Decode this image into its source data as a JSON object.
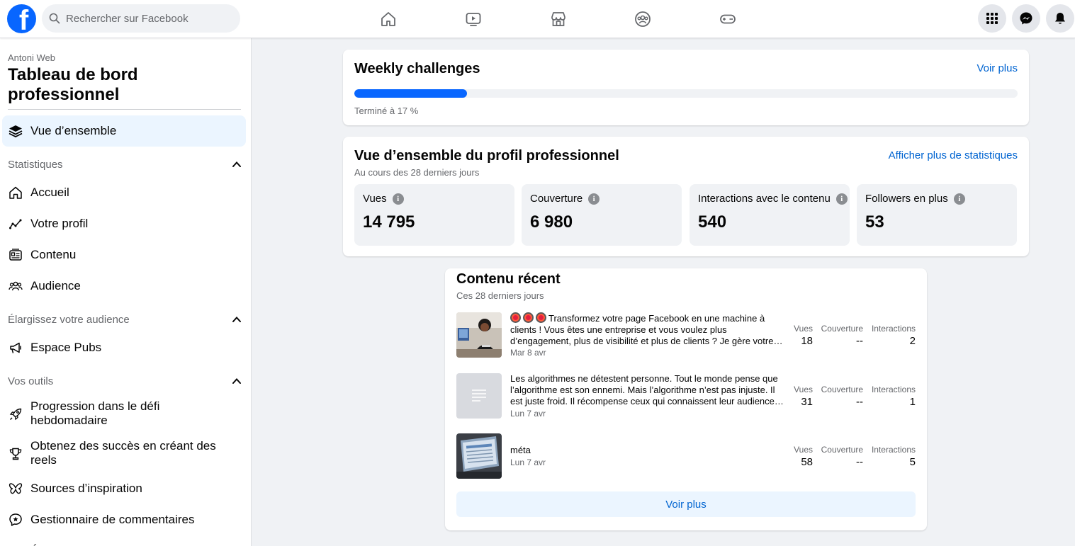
{
  "header": {
    "search_placeholder": "Rechercher sur Facebook",
    "logo_letter": "f",
    "nav_icons": [
      "home-icon",
      "video-icon",
      "marketplace-icon",
      "groups-icon",
      "gaming-icon"
    ],
    "right_icons": [
      "menu-grid-icon",
      "messenger-icon",
      "notifications-icon"
    ]
  },
  "sidebar": {
    "owner": "Antoni Web",
    "title": "Tableau de bord professionnel",
    "overview_label": "Vue d’ensemble",
    "sections": {
      "stats": "Statistiques",
      "expand": "Élargissez votre audience",
      "tools": "Vos outils"
    },
    "items": {
      "accueil": "Accueil",
      "profil": "Votre profil",
      "contenu": "Contenu",
      "audience": "Audience",
      "pubs": "Espace Pubs",
      "progression": "Progression dans le défi hebdomadaire",
      "succes": "Obtenez des succès en créant des reels",
      "inspiration": "Sources d’inspiration",
      "commentaires": "Gestionnaire de commentaires",
      "partial": "É"
    }
  },
  "weekly": {
    "title": "Weekly challenges",
    "link": "Voir plus",
    "progress_pct": 17,
    "status": "Terminé à 17 %"
  },
  "overview": {
    "title": "Vue d’ensemble du profil professionnel",
    "subtitle": "Au cours des 28 derniers jours",
    "link": "Afficher plus de statistiques",
    "stats": [
      {
        "label": "Vues",
        "value": "14 795"
      },
      {
        "label": "Couverture",
        "value": "6 980"
      },
      {
        "label": "Interactions avec le contenu",
        "value": "540"
      },
      {
        "label": "Followers en plus",
        "value": "53"
      }
    ]
  },
  "recent": {
    "title": "Contenu récent",
    "subtitle": "Ces 28 derniers jours",
    "metric_labels": {
      "views": "Vues",
      "reach": "Couverture",
      "interactions": "Interactions"
    },
    "posts": [
      {
        "text": "Transformez votre page Facebook en une machine à clients ! Vous êtes une entreprise et vous voulez plus d’engagement, plus de visibilité et plus de clients ? Je gère votre…",
        "date": "Mar 8 avr",
        "views": "18",
        "reach": "--",
        "interactions": "2"
      },
      {
        "text": "Les algorithmes ne détestent personne. Tout le monde pense que l’algorithme est son ennemi. Mais l’algorithme n’est pas injuste. Il est juste froid. Il récompense ceux qui connaissent leur audience…",
        "date": "Lun 7 avr",
        "views": "31",
        "reach": "--",
        "interactions": "1"
      },
      {
        "text": "méta",
        "date": "Lun 7 avr",
        "views": "58",
        "reach": "--",
        "interactions": "5"
      }
    ],
    "button": "Voir plus"
  },
  "colors": {
    "accent": "#0866ff",
    "link": "#0064d1",
    "background": "#f0f2f5"
  }
}
